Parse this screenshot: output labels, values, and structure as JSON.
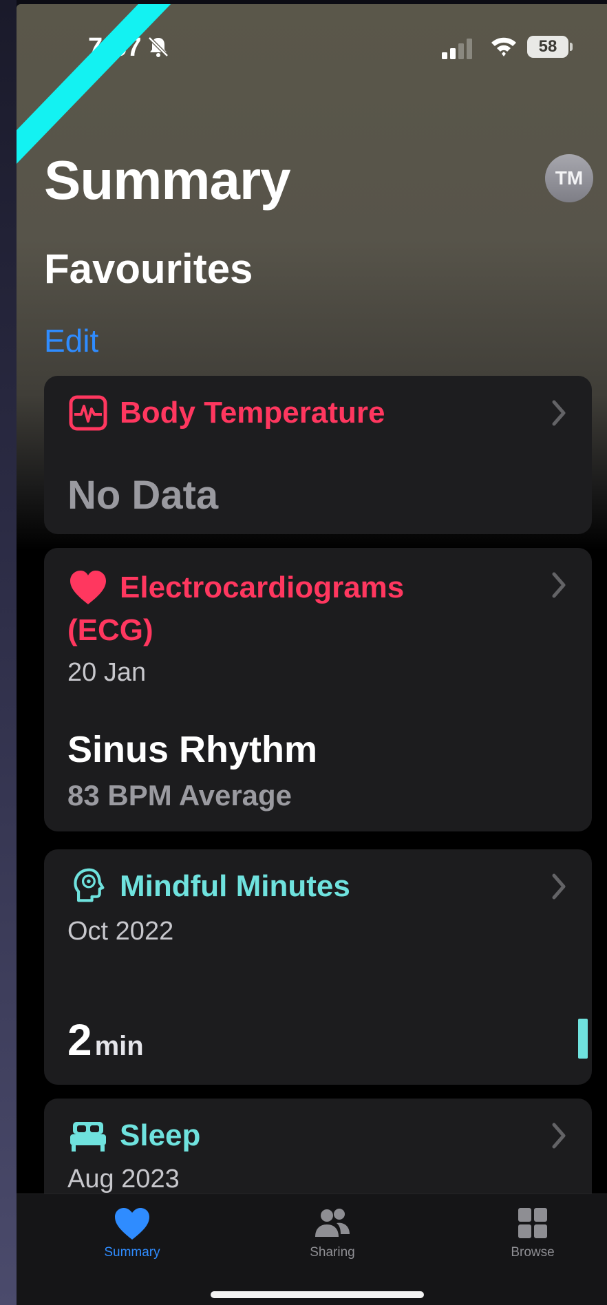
{
  "status_bar": {
    "time": "7:57",
    "battery": "58"
  },
  "header": {
    "title": "Summary",
    "avatar_initials": "TM",
    "section_title": "Favourites",
    "edit_label": "Edit"
  },
  "cards": [
    {
      "title": "Body Temperature",
      "icon": "waveform-chart-icon",
      "color": "#ff375f",
      "value": "No Data"
    },
    {
      "title_line1": "Electrocardiograms",
      "title_line2": "(ECG)",
      "icon": "heart-icon",
      "color": "#ff375f",
      "date": "20 Jan",
      "value": "Sinus Rhythm",
      "detail": "83 BPM Average"
    },
    {
      "title": "Mindful Minutes",
      "icon": "mind-head-icon",
      "color": "#6fe2de",
      "date": "Oct 2022",
      "value": "2",
      "unit": "min"
    },
    {
      "title": "Sleep",
      "icon": "bed-icon",
      "color": "#6fe2de",
      "date": "Aug 2023"
    }
  ],
  "tab_bar": {
    "items": [
      {
        "label": "Summary",
        "icon": "heart-icon",
        "selected": true
      },
      {
        "label": "Sharing",
        "icon": "people-icon",
        "selected": false
      },
      {
        "label": "Browse",
        "icon": "grid-icon",
        "selected": false
      }
    ]
  },
  "colors": {
    "accent_blue": "#2f8cff",
    "pink": "#ff375f",
    "teal": "#6fe2de",
    "annotation_line": "#13f2f2"
  }
}
